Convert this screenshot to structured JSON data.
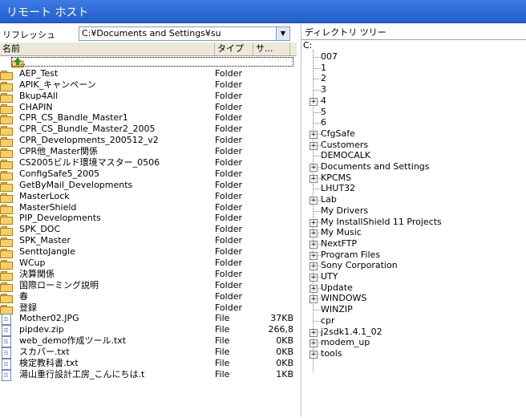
{
  "window": {
    "title": "リモート ホスト"
  },
  "toolbar": {
    "refresh_label": "リフレッシュ",
    "path_value": "C:¥Documents and Settings¥su"
  },
  "list": {
    "columns": [
      "名前",
      "タイプ",
      "サ..."
    ],
    "up_label": "..",
    "rows": [
      {
        "name": "AEP_Test",
        "type": "Folder",
        "size": "",
        "kind": "folder"
      },
      {
        "name": "APIK_キャンペーン",
        "type": "Folder",
        "size": "",
        "kind": "folder"
      },
      {
        "name": "Bkup4All",
        "type": "Folder",
        "size": "",
        "kind": "folder"
      },
      {
        "name": "CHAPIN",
        "type": "Folder",
        "size": "",
        "kind": "folder"
      },
      {
        "name": "CPR_CS_Bandle_Master1",
        "type": "Folder",
        "size": "",
        "kind": "folder"
      },
      {
        "name": "CPR_CS_Bundle_Master2_2005",
        "type": "Folder",
        "size": "",
        "kind": "folder"
      },
      {
        "name": "CPR_Developments_200512_v2",
        "type": "Folder",
        "size": "",
        "kind": "folder"
      },
      {
        "name": "CPR他_Master関係",
        "type": "Folder",
        "size": "",
        "kind": "folder"
      },
      {
        "name": "CS2005ビルド環境マスター_0506",
        "type": "Folder",
        "size": "",
        "kind": "folder"
      },
      {
        "name": "ConfigSafe5_2005",
        "type": "Folder",
        "size": "",
        "kind": "folder"
      },
      {
        "name": "GetByMail_Developments",
        "type": "Folder",
        "size": "",
        "kind": "folder"
      },
      {
        "name": "MasterLock",
        "type": "Folder",
        "size": "",
        "kind": "folder"
      },
      {
        "name": "MasterShield",
        "type": "Folder",
        "size": "",
        "kind": "folder"
      },
      {
        "name": "PIP_Developments",
        "type": "Folder",
        "size": "",
        "kind": "folder"
      },
      {
        "name": "SPK_DOC",
        "type": "Folder",
        "size": "",
        "kind": "folder"
      },
      {
        "name": "SPK_Master",
        "type": "Folder",
        "size": "",
        "kind": "folder"
      },
      {
        "name": "SenttoJangle",
        "type": "Folder",
        "size": "",
        "kind": "folder"
      },
      {
        "name": "WCup",
        "type": "Folder",
        "size": "",
        "kind": "folder"
      },
      {
        "name": "決算関係",
        "type": "Folder",
        "size": "",
        "kind": "folder"
      },
      {
        "name": "国際ローミング説明",
        "type": "Folder",
        "size": "",
        "kind": "folder"
      },
      {
        "name": "春",
        "type": "Folder",
        "size": "",
        "kind": "folder"
      },
      {
        "name": "登録",
        "type": "Folder",
        "size": "",
        "kind": "folder"
      },
      {
        "name": "Mother02.JPG",
        "type": "File",
        "size": "37KB",
        "kind": "file"
      },
      {
        "name": "pipdev.zip",
        "type": "File",
        "size": "266,8",
        "kind": "file"
      },
      {
        "name": "web_demo作成ツール.txt",
        "type": "File",
        "size": "0KB",
        "kind": "file"
      },
      {
        "name": "スカパー.txt",
        "type": "File",
        "size": "0KB",
        "kind": "file"
      },
      {
        "name": "検定教科書.txt",
        "type": "File",
        "size": "0KB",
        "kind": "file"
      },
      {
        "name": "湯山重行設計工房_こんにちは.t",
        "type": "File",
        "size": "1KB",
        "kind": "file"
      }
    ]
  },
  "tree": {
    "title": "ディレクトリ ツリー",
    "root": "C:",
    "items": [
      {
        "label": "007",
        "expandable": false
      },
      {
        "label": "1",
        "expandable": false
      },
      {
        "label": "2",
        "expandable": false
      },
      {
        "label": "3",
        "expandable": false
      },
      {
        "label": "4",
        "expandable": true
      },
      {
        "label": "5",
        "expandable": false
      },
      {
        "label": "6",
        "expandable": false
      },
      {
        "label": "CfgSafe",
        "expandable": true
      },
      {
        "label": "Customers",
        "expandable": true
      },
      {
        "label": "DEMOCALK",
        "expandable": false
      },
      {
        "label": "Documents and Settings",
        "expandable": true
      },
      {
        "label": "KPCMS",
        "expandable": true
      },
      {
        "label": "LHUT32",
        "expandable": false
      },
      {
        "label": "Lab",
        "expandable": true
      },
      {
        "label": "My Drivers",
        "expandable": false
      },
      {
        "label": "My InstallShield 11 Projects",
        "expandable": true
      },
      {
        "label": "My Music",
        "expandable": true
      },
      {
        "label": "NextFTP",
        "expandable": true
      },
      {
        "label": "Program Files",
        "expandable": true
      },
      {
        "label": "Sony Corporation",
        "expandable": true
      },
      {
        "label": "UTY",
        "expandable": true
      },
      {
        "label": "Update",
        "expandable": true
      },
      {
        "label": "WINDOWS",
        "expandable": true
      },
      {
        "label": "WINZIP",
        "expandable": false
      },
      {
        "label": "cpr",
        "expandable": false
      },
      {
        "label": "j2sdk1.4.1_02",
        "expandable": true
      },
      {
        "label": "modem_up",
        "expandable": true
      },
      {
        "label": "tools",
        "expandable": true
      }
    ]
  }
}
